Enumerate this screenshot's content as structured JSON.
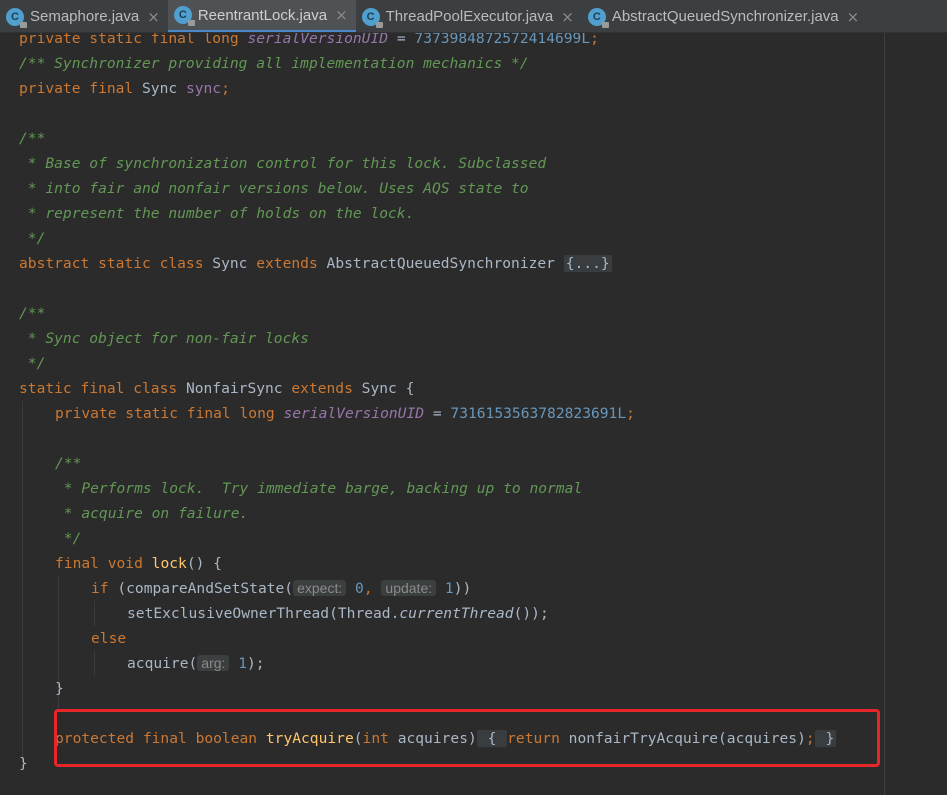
{
  "tabs": [
    {
      "label": "Semaphore.java",
      "active": false
    },
    {
      "label": "ReentrantLock.java",
      "active": true
    },
    {
      "label": "ThreadPoolExecutor.java",
      "active": false
    },
    {
      "label": "AbstractQueuedSynchronizer.java",
      "active": false
    }
  ],
  "tab_close_glyph": "×",
  "code": {
    "l1": {
      "a": "private static final long ",
      "b": "serialVersionUID",
      "c": " = ",
      "d": "7373984872572414699L",
      "e": ";"
    },
    "l2": {
      "a": "/** Synchronizer providing all implementation mechanics */"
    },
    "l3": {
      "a": "private final ",
      "b": "Sync ",
      "c": "sync",
      "d": ";"
    },
    "l5": {
      "a": "/**"
    },
    "l6": {
      "a": " * Base of synchronization control for this lock. Subclassed"
    },
    "l7": {
      "a": " * into fair and nonfair versions below. Uses AQS state to"
    },
    "l8": {
      "a": " * represent the number of holds on the lock."
    },
    "l9": {
      "a": " */"
    },
    "l10": {
      "a": "abstract static class ",
      "b": "Sync ",
      "c": "extends ",
      "d": "AbstractQueuedSynchronizer ",
      "e": "{...}"
    },
    "l12": {
      "a": "/**"
    },
    "l13": {
      "a": " * Sync object for non-fair locks"
    },
    "l14": {
      "a": " */"
    },
    "l15": {
      "a": "static final class ",
      "b": "NonfairSync ",
      "c": "extends ",
      "d": "Sync {"
    },
    "l16": {
      "a": "private static final long ",
      "b": "serialVersionUID",
      "c": " = ",
      "d": "7316153563782823691L",
      "e": ";"
    },
    "l18": {
      "a": "/**"
    },
    "l19": {
      "a": " * Performs lock.  Try immediate barge, backing up to normal"
    },
    "l20": {
      "a": " * acquire on failure."
    },
    "l21": {
      "a": " */"
    },
    "l22": {
      "a": "final void ",
      "b": "lock",
      "c": "() {"
    },
    "l23": {
      "a": "if ",
      "b": "(compareAndSetState(",
      "h1": "expect:",
      "c": " ",
      "d": "0",
      "e": ", ",
      "h2": "update:",
      "f": " ",
      "g": "1",
      "i": "))"
    },
    "l24": {
      "a": "setExclusiveOwnerThread(Thread.",
      "b": "currentThread",
      "c": "());"
    },
    "l25": {
      "a": "else"
    },
    "l26": {
      "a": "acquire(",
      "h1": "arg:",
      "b": " ",
      "c": "1",
      "d": ");"
    },
    "l27": {
      "a": "}"
    },
    "l29": {
      "a": "protected final boolean ",
      "b": "tryAcquire",
      "c": "(",
      "d": "int ",
      "e": "acquires)",
      "f": " { ",
      "g": "return ",
      "h": "nonfairTryAcquire(acquires)",
      "i": ";",
      "j": " }"
    },
    "l30": {
      "a": "}"
    }
  },
  "colors": {
    "keyword": "#cc7832",
    "comment": "#629755",
    "field": "#9876aa",
    "number": "#6897bb",
    "function": "#ffc66d",
    "text": "#a9b7c6",
    "highlight": "#e8262a"
  }
}
